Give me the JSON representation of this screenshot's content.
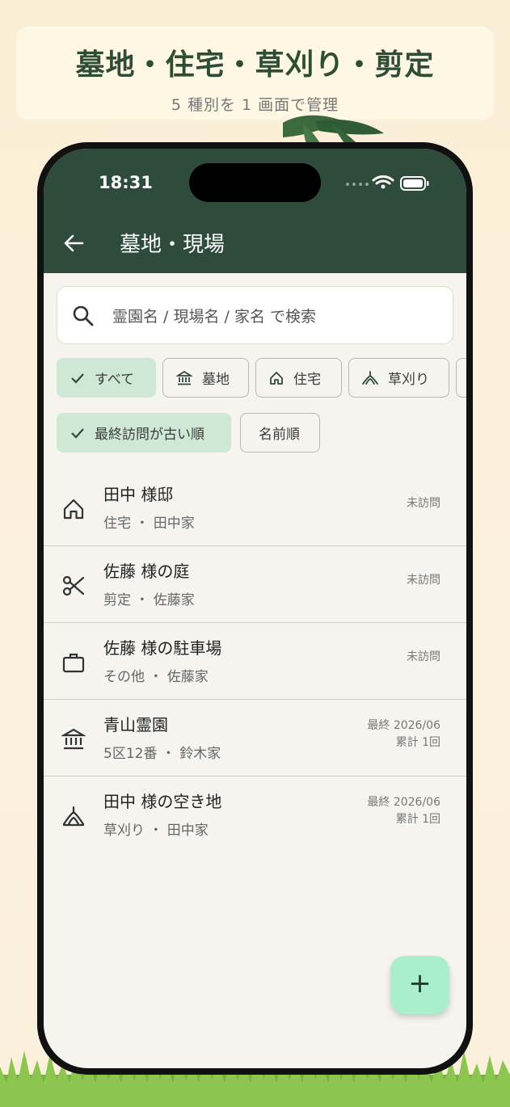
{
  "promo": {
    "title": "墓地・住宅・草刈り・剪定",
    "subtitle": "5 種別を 1 画面で管理"
  },
  "status_bar": {
    "time": "18:31"
  },
  "header": {
    "title": "墓地・現場"
  },
  "search": {
    "placeholder": "霊園名 / 現場名 / 家名 で検索"
  },
  "type_filters": [
    {
      "label": "すべて",
      "icon": "check-icon",
      "selected": true
    },
    {
      "label": "墓地",
      "icon": "cemetery-icon",
      "selected": false
    },
    {
      "label": "住宅",
      "icon": "house-icon",
      "selected": false
    },
    {
      "label": "草刈り",
      "icon": "grass-icon",
      "selected": false
    }
  ],
  "sort_options": [
    {
      "label": "最終訪問が古い順",
      "icon": "check-icon",
      "selected": true
    },
    {
      "label": "名前順",
      "selected": false
    }
  ],
  "sites": [
    {
      "title": "田中 様邸",
      "subtitle": "住宅 ・ 田中家",
      "icon": "house-icon",
      "meta1": "未訪問",
      "meta2": ""
    },
    {
      "title": "佐藤 様の庭",
      "subtitle": "剪定 ・ 佐藤家",
      "icon": "scissors-icon",
      "meta1": "未訪問",
      "meta2": ""
    },
    {
      "title": "佐藤 様の駐車場",
      "subtitle": "その他 ・ 佐藤家",
      "icon": "briefcase-icon",
      "meta1": "未訪問",
      "meta2": ""
    },
    {
      "title": "青山霊園",
      "subtitle": "5区12番 ・ 鈴木家",
      "icon": "cemetery-icon",
      "meta1": "最終 2026/06",
      "meta2": "累計 1回"
    },
    {
      "title": "田中 様の空き地",
      "subtitle": "草刈り ・ 田中家",
      "icon": "grass-icon",
      "meta1": "最終 2026/06",
      "meta2": "累計 1回"
    }
  ],
  "fab": {
    "label": "+"
  },
  "colors": {
    "header_bg": "#2e4b3c",
    "chip_selected_bg": "#cfe8d6",
    "fab_bg": "#a9efcc",
    "promo_title": "#2f4d35"
  }
}
